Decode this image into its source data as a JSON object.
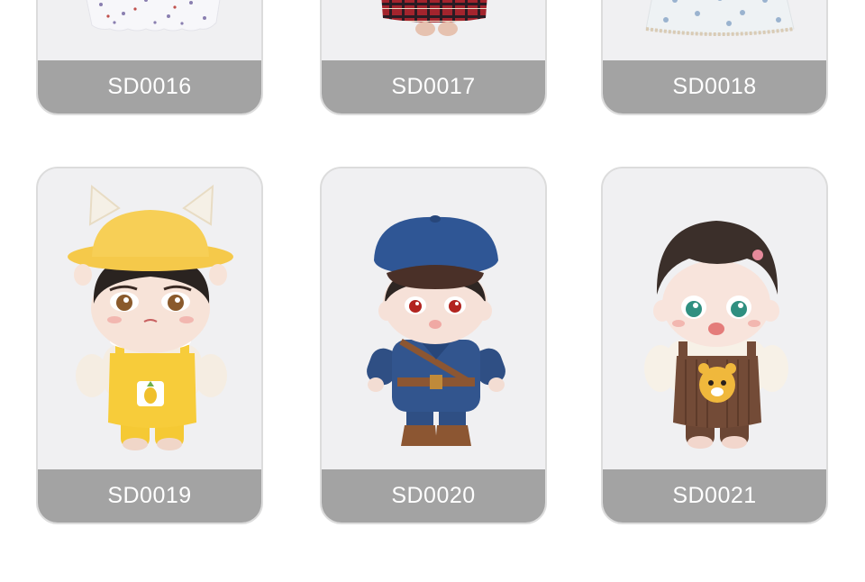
{
  "products": [
    {
      "code": "SD0016",
      "thumbnail": "doll-in-starry-white-skirt"
    },
    {
      "code": "SD0017",
      "thumbnail": "doll-in-red-plaid-skirt"
    },
    {
      "code": "SD0018",
      "thumbnail": "doll-in-floral-lace-skirt"
    },
    {
      "code": "SD0019",
      "thumbnail": "doll-in-yellow-cat-ear-hat-and-overalls"
    },
    {
      "code": "SD0020",
      "thumbnail": "doll-in-navy-cap-and-uniform"
    },
    {
      "code": "SD0021",
      "thumbnail": "doll-in-brown-tiger-overalls"
    }
  ],
  "colors": {
    "card_background": "#f0f0f2",
    "card_border": "#dcdcdc",
    "label_background": "#a3a3a3",
    "label_text": "#ffffff"
  }
}
